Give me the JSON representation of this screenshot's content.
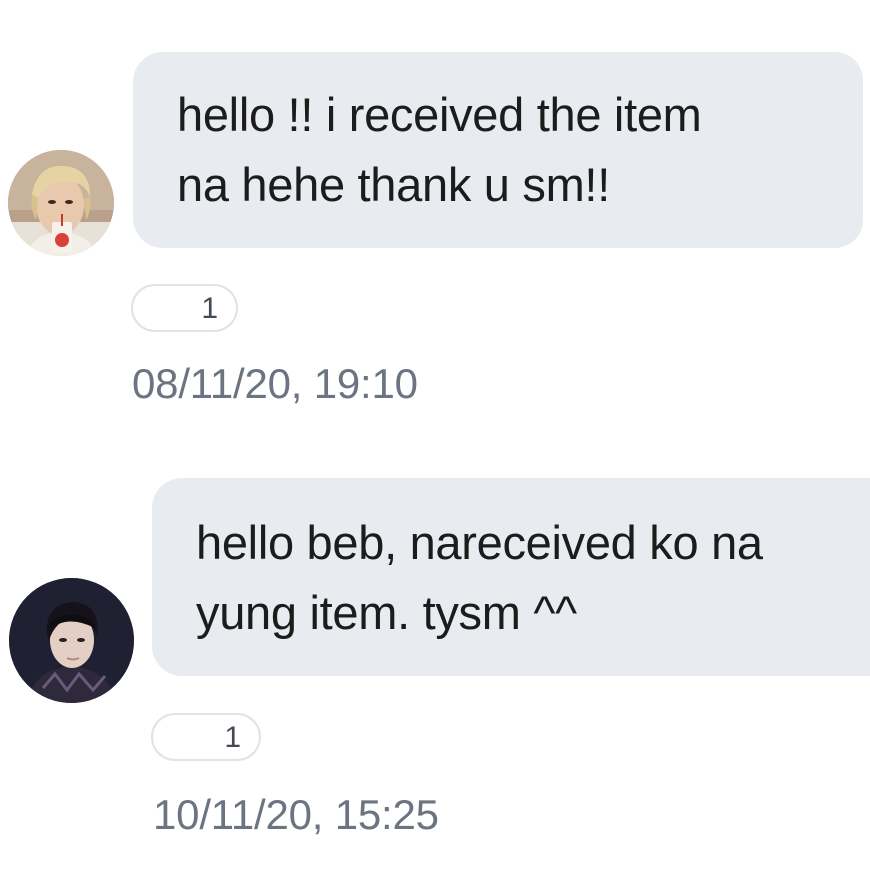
{
  "messages": [
    {
      "avatar": "avatar-blonde-with-juice-box",
      "lines": [
        "hello !! i received the item",
        "na hehe thank u sm!!"
      ],
      "count": "1",
      "timestamp": "08/11/20, 19:10"
    },
    {
      "avatar": "avatar-dark-hair-portrait",
      "lines": [
        "hello beb, nareceived ko na",
        "yung item. tysm ^^"
      ],
      "count": "1",
      "timestamp": "10/11/20, 15:25"
    }
  ],
  "colors": {
    "bubble_bg": "#e8ebf0",
    "timestamp": "#6c7381",
    "pill_border": "#dfe2e7",
    "text": "#1c1c1c"
  }
}
